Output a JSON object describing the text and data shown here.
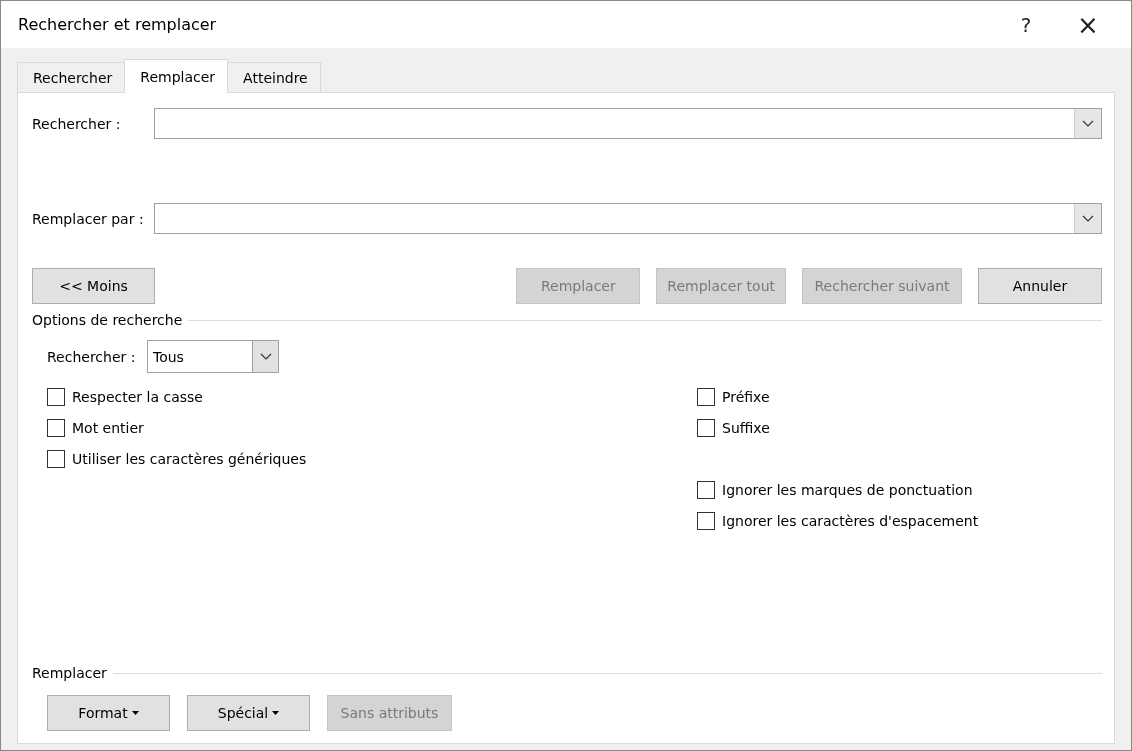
{
  "window": {
    "title": "Rechercher et remplacer",
    "help": "?",
    "close": "×"
  },
  "tabs": [
    {
      "label": "Rechercher",
      "selected": false
    },
    {
      "label": "Remplacer",
      "selected": true
    },
    {
      "label": "Atteindre",
      "selected": false
    }
  ],
  "fields": [
    {
      "label": "Rechercher :"
    },
    {
      "label": "Remplacer par :"
    }
  ],
  "more_button": {
    "label": "<< Moins",
    "disabled": false
  },
  "action_buttons": [
    {
      "label": "Remplacer",
      "disabled": true
    },
    {
      "label": "Remplacer tout",
      "disabled": true
    },
    {
      "label": "Rechercher suivant",
      "disabled": true
    },
    {
      "label": "Annuler",
      "disabled": false
    }
  ],
  "search_options": {
    "title": "Options de recherche",
    "direction": {
      "label": "Rechercher :",
      "value": "Tous"
    },
    "left": [
      {
        "label": "Respecter la casse",
        "checked": false
      },
      {
        "label": "Mot entier",
        "checked": false
      },
      {
        "label": "Utiliser les caractères génériques",
        "checked": false
      }
    ],
    "right": [
      {
        "label": "Préfixe",
        "checked": false
      },
      {
        "label": "Suffixe",
        "checked": false
      },
      {
        "label": "Ignorer les marques de ponctuation",
        "checked": false
      },
      {
        "label": "Ignorer les caractères d'espacement",
        "checked": false
      }
    ]
  },
  "replace_section": {
    "title": "Remplacer",
    "buttons": [
      {
        "label": "Format",
        "dropdown": true,
        "disabled": false
      },
      {
        "label": "Spécial",
        "dropdown": true,
        "disabled": false
      },
      {
        "label": "Sans attributs",
        "dropdown": false,
        "disabled": true
      }
    ]
  }
}
